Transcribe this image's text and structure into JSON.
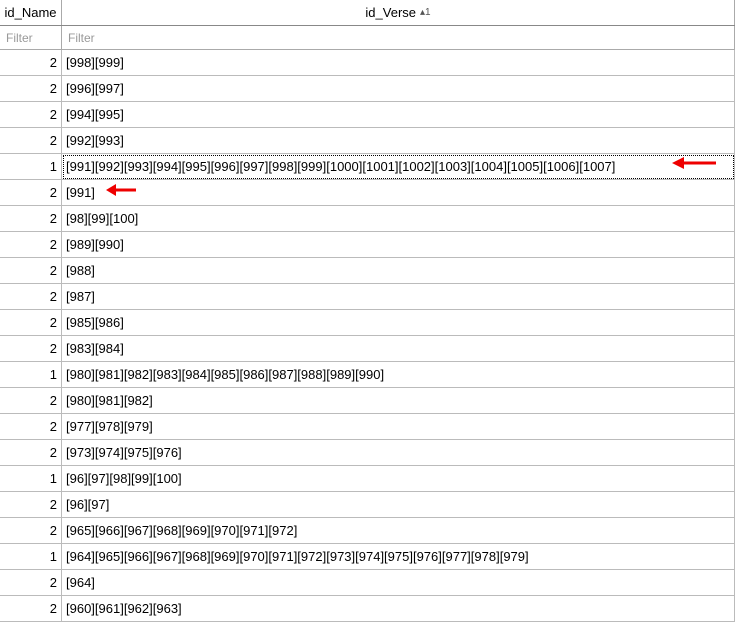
{
  "header": {
    "col_name": "id_Name",
    "col_verse": "id_Verse",
    "sort_indicator": "▴1"
  },
  "filter": {
    "placeholder": "Filter"
  },
  "selected_row_index": 4,
  "rows": [
    {
      "idName": "2",
      "idVerse": "[998][999]"
    },
    {
      "idName": "2",
      "idVerse": "[996][997]"
    },
    {
      "idName": "2",
      "idVerse": "[994][995]"
    },
    {
      "idName": "2",
      "idVerse": "[992][993]"
    },
    {
      "idName": "1",
      "idVerse": "[991][992][993][994][995][996][997][998][999][1000][1001][1002][1003][1004][1005][1006][1007]"
    },
    {
      "idName": "2",
      "idVerse": "[991]"
    },
    {
      "idName": "2",
      "idVerse": "[98][99][100]"
    },
    {
      "idName": "2",
      "idVerse": "[989][990]"
    },
    {
      "idName": "2",
      "idVerse": "[988]"
    },
    {
      "idName": "2",
      "idVerse": "[987]"
    },
    {
      "idName": "2",
      "idVerse": "[985][986]"
    },
    {
      "idName": "2",
      "idVerse": "[983][984]"
    },
    {
      "idName": "1",
      "idVerse": "[980][981][982][983][984][985][986][987][988][989][990]"
    },
    {
      "idName": "2",
      "idVerse": "[980][981][982]"
    },
    {
      "idName": "2",
      "idVerse": "[977][978][979]"
    },
    {
      "idName": "2",
      "idVerse": "[973][974][975][976]"
    },
    {
      "idName": "1",
      "idVerse": "[96][97][98][99][100]"
    },
    {
      "idName": "2",
      "idVerse": "[96][97]"
    },
    {
      "idName": "2",
      "idVerse": "[965][966][967][968][969][970][971][972]"
    },
    {
      "idName": "1",
      "idVerse": "[964][965][966][967][968][969][970][971][972][973][974][975][976][977][978][979]"
    },
    {
      "idName": "2",
      "idVerse": "[964]"
    },
    {
      "idName": "2",
      "idVerse": "[960][961][962][963]"
    }
  ]
}
